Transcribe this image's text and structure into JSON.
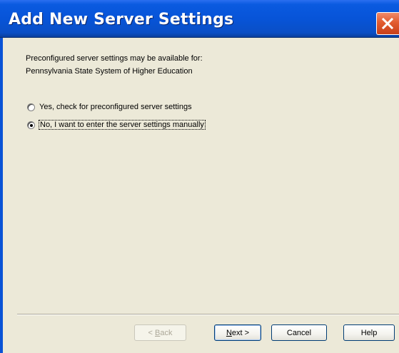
{
  "window": {
    "title": "Add New Server Settings",
    "close_icon": "close-icon"
  },
  "intro": {
    "line1": "Preconfigured server settings may be available for:",
    "line2": "Pennsylvania State System of Higher Education"
  },
  "options": [
    {
      "label": "Yes, check for preconfigured server settings",
      "selected": false
    },
    {
      "label": "No, I want to enter the server settings manually",
      "selected": true
    }
  ],
  "buttons": {
    "back": {
      "mnemonic": "B",
      "rest": "ack",
      "prefix": "< ",
      "enabled": false
    },
    "next": {
      "mnemonic": "N",
      "rest": "ext >",
      "enabled": true
    },
    "cancel": "Cancel",
    "help": "Help"
  },
  "colors": {
    "title_bar": "#0754d8",
    "client_bg": "#ece9d8",
    "close_button": "#e25b2f"
  }
}
